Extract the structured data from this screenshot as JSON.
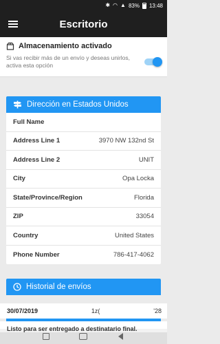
{
  "status_bar": {
    "battery": "83%",
    "time": "13:48"
  },
  "app_bar": {
    "title": "Escritorio"
  },
  "storage": {
    "title": "Almacenamiento activado",
    "description": "Si vas recibir más de un envío y deseas unirlos, activa esta opción",
    "enabled": true
  },
  "address_card": {
    "header": "Dirección en Estados Unidos",
    "rows": [
      {
        "label": "Full Name",
        "value": ""
      },
      {
        "label": "Address Line 1",
        "value": "3970 NW 132nd St"
      },
      {
        "label": "Address Line 2",
        "value": "UNIT"
      },
      {
        "label": "City",
        "value": "Opa Locka"
      },
      {
        "label": "State/Province/Region",
        "value": "Florida"
      },
      {
        "label": "ZIP",
        "value": "33054"
      },
      {
        "label": "Country",
        "value": "United States"
      },
      {
        "label": "Phone Number",
        "value": "786-417-4062"
      }
    ]
  },
  "history_card": {
    "header": "Historial de envíos",
    "date": "30/07/2019",
    "middle": "1z(",
    "right": "'28",
    "status": "Listo para ser entregado a destinatario final.",
    "progress": 1.0
  },
  "colors": {
    "accent": "#2196f3",
    "app_bar": "#1f1f1f",
    "background": "#ebebeb"
  }
}
